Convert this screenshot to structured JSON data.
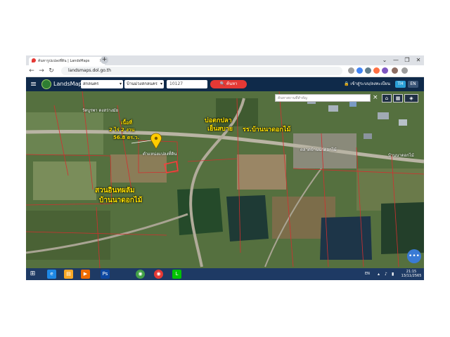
{
  "browser": {
    "tab_title": "ค้นหารูปแปลงที่ดิน | LandsMaps",
    "tab_close": "×",
    "new_tab": "+",
    "window_controls": [
      "⌄",
      "—",
      "❐",
      "✕"
    ],
    "nav": {
      "back": "←",
      "forward": "→",
      "reload": "↻"
    },
    "url": "landsmaps.dol.go.th"
  },
  "app": {
    "brand": "LandsMaps",
    "province_select": "สกลนคร",
    "district_select": "บ้านม่วงสกลนคร",
    "parcel_number": "10127",
    "search_button": "ค้นหา",
    "login_label": "เข้าสู่ระบบ/ลงทะเบียน",
    "lang_th": "TH",
    "lang_en": "EN",
    "colors": {
      "header": "#0f2a4a",
      "search_button": "#e53935",
      "lang_active": "#2a9fd6"
    }
  },
  "map": {
    "search_placeholder": "ค้นหาสถานที่สำคัญ",
    "close": "×",
    "labels": {
      "area_title": "เนื้อที่",
      "area_line1": "2 ไร่ 2 งาน",
      "area_line2": "56.8 ตร.ว.",
      "pin_label": "ตำแหน่งแปลงที่ดิน",
      "market": "บ่อตกปลา",
      "market2": "เย็นสบาย",
      "school": "รร.บ้านนาดอกไม้",
      "garden1": "สวนอินทผลัม",
      "garden2": "บ้านนาดอกไม้",
      "temple": "วัดบูรพา ดงสว่างมัย",
      "road_right": "บ้านนาดอกไม้",
      "place_right": "ตลาดบ้านนาดอกไม้"
    },
    "pin_color": "#ffcc00"
  },
  "taskbar": {
    "start": "⊞",
    "lang": "EN",
    "time": "21:15",
    "date": "13/11/2565",
    "apps": [
      {
        "name": "internet-explorer",
        "glyph": "e",
        "color": "#1e88e5"
      },
      {
        "name": "file-explorer",
        "glyph": "▤",
        "color": "#f9a825"
      },
      {
        "name": "media-player",
        "glyph": "▶",
        "color": "#ef6c00"
      },
      {
        "name": "photoshop",
        "glyph": "Ps",
        "color": "#0d47a1"
      },
      {
        "name": "chrome",
        "glyph": "◉",
        "color": "#43a047"
      },
      {
        "name": "chrome-2",
        "glyph": "◉",
        "color": "#e53935"
      },
      {
        "name": "line",
        "glyph": "L",
        "color": "#00c300"
      }
    ]
  }
}
